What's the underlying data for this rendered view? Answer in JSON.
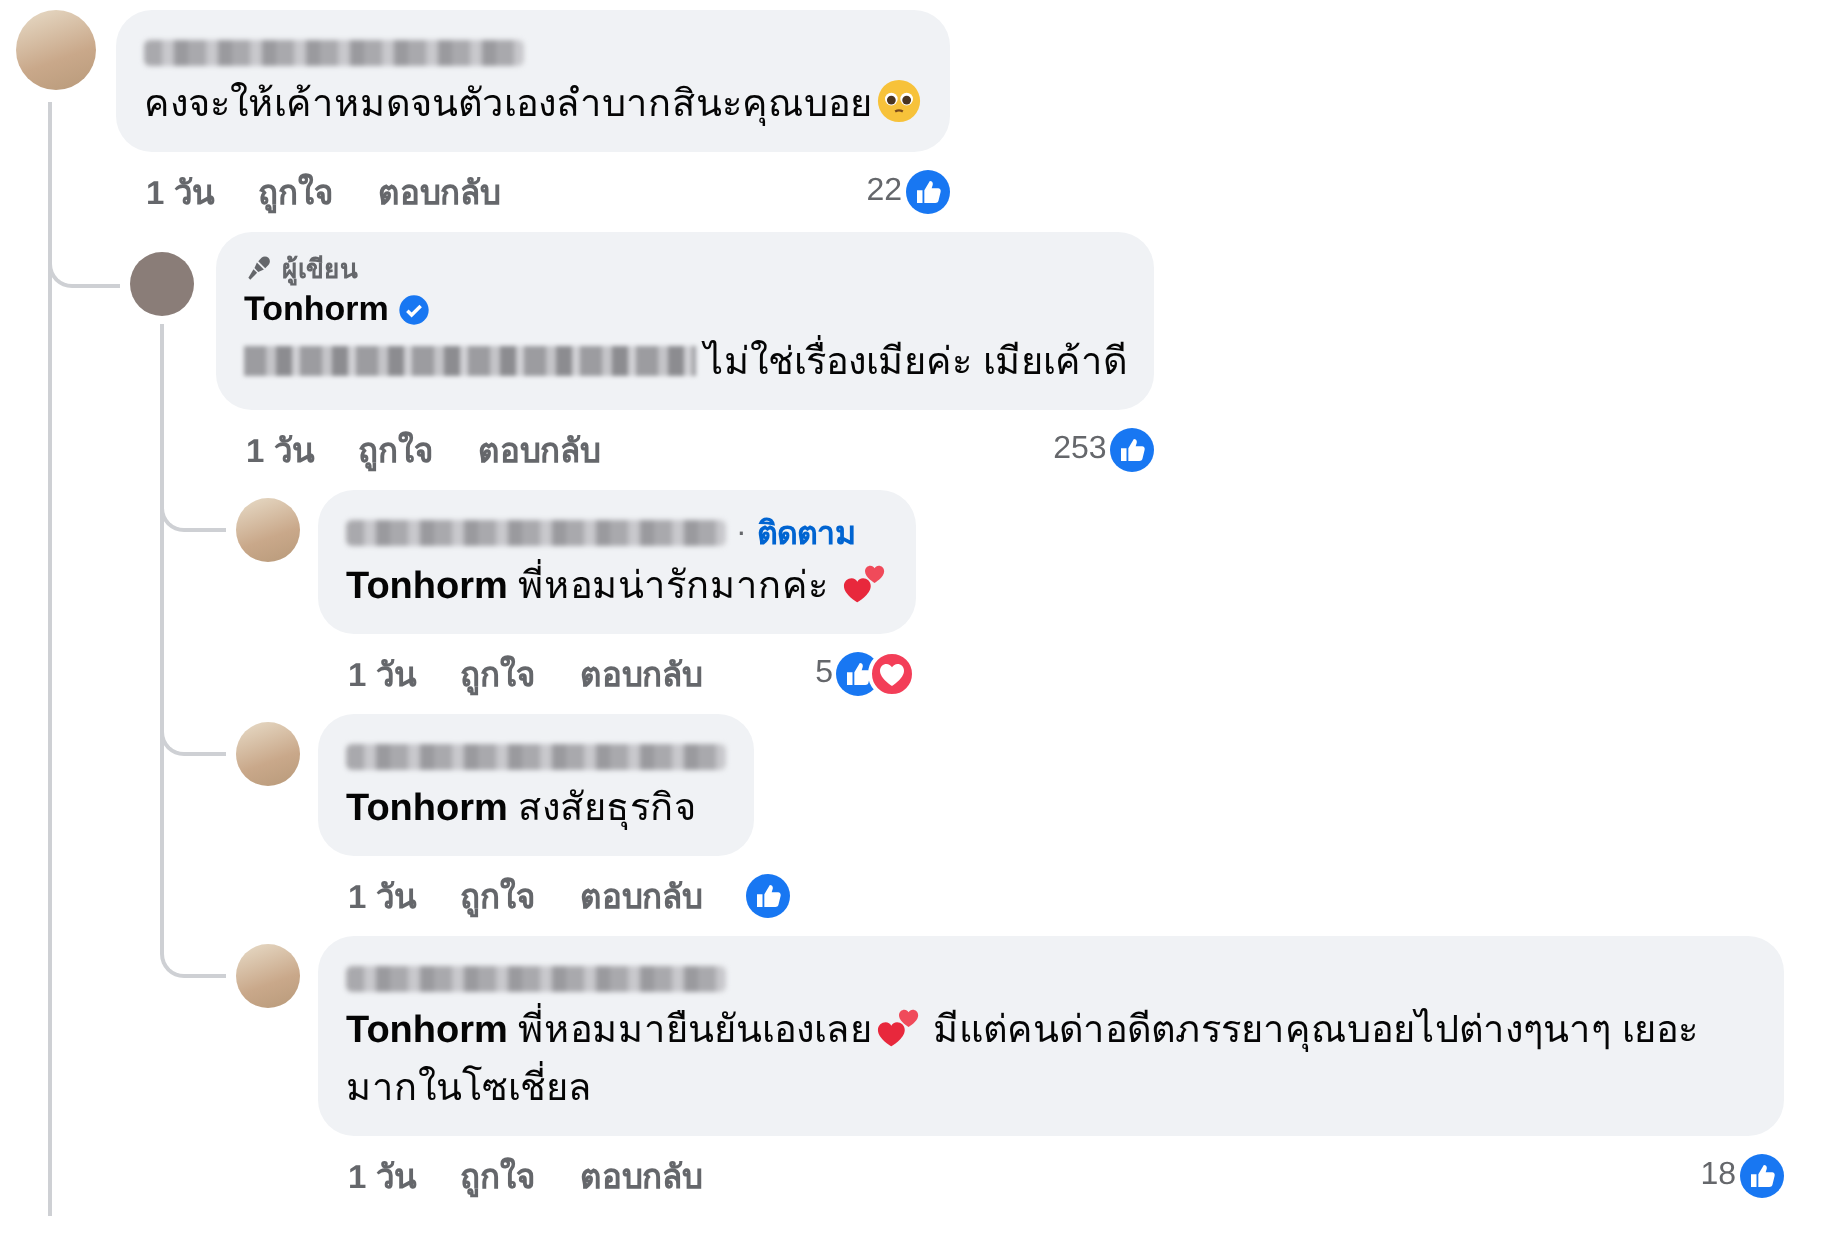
{
  "comments": [
    {
      "avatar": {
        "kind": "blurred"
      },
      "name_blurred": true,
      "segments": [
        {
          "kind": "text",
          "text": "คงจะให้เค้าหมดจนตัวเองลำบากสินะคุณบอย"
        },
        {
          "kind": "pleading_emoji"
        }
      ],
      "time": "1 วัน",
      "like_action": "ถูกใจ",
      "reply_action": "ตอบกลับ",
      "reactions": {
        "count": "22",
        "icons": [
          {
            "kind": "like"
          }
        ]
      },
      "children": [
        {
          "avatar": {
            "kind": "photo"
          },
          "badge": "ผู้เขียน",
          "name": "Tonhorm",
          "verified": true,
          "segments": [
            {
              "kind": "blurred"
            },
            {
              "kind": "text",
              "text": "ไม่ใช่เรื่องเมียค่ะ เมียเค้าดี"
            }
          ],
          "time": "1 วัน",
          "like_action": "ถูกใจ",
          "reply_action": "ตอบกลับ",
          "reactions": {
            "count": "253",
            "icons": [
              {
                "kind": "like"
              }
            ]
          },
          "children": [
            {
              "avatar": {
                "kind": "blurred"
              },
              "name_blurred": true,
              "follow": {
                "separator": "·",
                "label": "ติดตาม"
              },
              "segments": [
                {
                  "kind": "text",
                  "text": "**Tonhorm** พี่หอมน่ารักมากค่ะ "
                },
                {
                  "kind": "hearts_emoji"
                }
              ],
              "time": "1 วัน",
              "like_action": "ถูกใจ",
              "reply_action": "ตอบกลับ",
              "reactions": {
                "count": "5",
                "icons": [
                  {
                    "kind": "like"
                  },
                  {
                    "kind": "love"
                  }
                ]
              }
            },
            {
              "avatar": {
                "kind": "blurred"
              },
              "name_blurred": true,
              "segments": [
                {
                  "kind": "text",
                  "text": "**Tonhorm** สงสัยธุรกิจ"
                }
              ],
              "time": "1 วัน",
              "like_action": "ถูกใจ",
              "reply_action": "ตอบกลับ",
              "reactions": {
                "icons": [
                  {
                    "kind": "like"
                  }
                ]
              }
            },
            {
              "avatar": {
                "kind": "blurred"
              },
              "name_blurred": true,
              "segments": [
                {
                  "kind": "text",
                  "text": "**Tonhorm** พี่หอมมายืนยันเองเลย"
                },
                {
                  "kind": "hearts_emoji"
                },
                {
                  "kind": "text",
                  "text": " มีแต่คนด่าอดีตภรรยาคุณบอยไปต่างๆนาๆ เยอะมากในโซเชี่ยล"
                }
              ],
              "time": "1 วัน",
              "like_action": "ถูกใจ",
              "reply_action": "ตอบกลับ",
              "reactions": {
                "count": "18",
                "icons": [
                  {
                    "kind": "like"
                  }
                ]
              }
            }
          ]
        }
      ]
    }
  ]
}
